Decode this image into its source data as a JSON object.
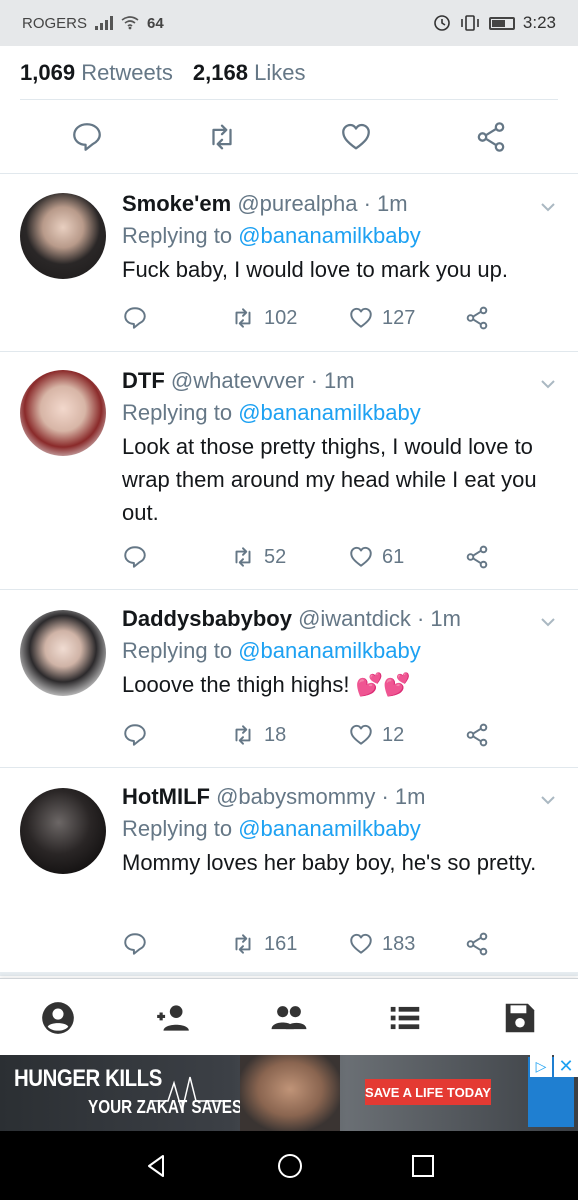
{
  "status_bar": {
    "carrier": "ROGERS",
    "signal_label": "64",
    "time": "3:23"
  },
  "stats": {
    "retweets_count": "1,069",
    "retweets_label": "Retweets",
    "likes_count": "2,168",
    "likes_label": "Likes"
  },
  "replies": [
    {
      "display_name": "Smoke'em",
      "meta": "@purealpha · 1m",
      "replying_prefix": "Replying to",
      "replying_handle": "@bananamilkbaby",
      "text": "Fuck baby, I would love to mark you up.",
      "retweets": "102",
      "likes": "127"
    },
    {
      "display_name": "DTF",
      "meta": "@whatevvver · 1m",
      "replying_prefix": "Replying to",
      "replying_handle": "@bananamilkbaby",
      "text": "Look at those pretty thighs, I would love to wrap them around my head while I eat you out.",
      "retweets": "52",
      "likes": "61"
    },
    {
      "display_name": "Daddysbabyboy",
      "meta": "@iwantdick · 1m",
      "replying_prefix": "Replying to",
      "replying_handle": "@bananamilkbaby",
      "text": "Looove the thigh highs! 💕💕",
      "retweets": "18",
      "likes": "12"
    },
    {
      "display_name": "HotMILF",
      "meta": "@babysmommy · 1m",
      "replying_prefix": "Replying to",
      "replying_handle": "@bananamilkbaby",
      "text": "Mommy loves her baby boy, he's so pretty.",
      "retweets": "161",
      "likes": "183"
    }
  ],
  "ad": {
    "title": "HUNGER KILLS",
    "subtitle": "YOUR ZAKAT SAVES",
    "cta": "SAVE A LIFE TODAY"
  },
  "colors": {
    "accent": "#1da1f2",
    "secondary_text": "#657786",
    "icon_gray": "#657786"
  },
  "icons": {
    "reply": "reply-icon",
    "retweet": "retweet-icon",
    "like": "heart-icon",
    "share": "share-icon",
    "profile": "profile-icon",
    "add_user": "add-user-icon",
    "people": "people-icon",
    "lists": "list-icon",
    "save": "save-icon"
  }
}
